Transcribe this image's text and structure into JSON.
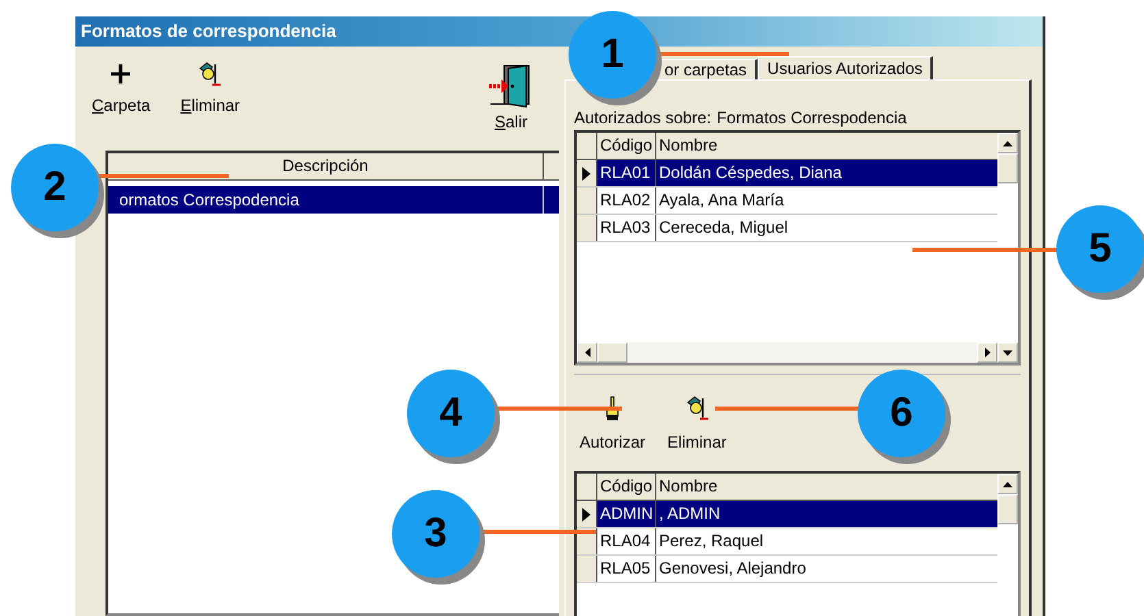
{
  "window": {
    "title": "Formatos de correspondencia"
  },
  "toolbar": [
    {
      "kind": "add",
      "label": "Carpeta",
      "underline_first": true
    },
    {
      "kind": "delete",
      "label": "Eliminar",
      "underline_first": true
    }
  ],
  "exit_button": {
    "label": "Salir",
    "underline_first": true
  },
  "folders_table": {
    "columns": [
      "Descripción"
    ],
    "rows": [
      {
        "cells": [
          "ormatos Correspodencia"
        ],
        "selected": true
      }
    ]
  },
  "tabs": [
    {
      "label": "or carpetas",
      "selected": false
    },
    {
      "label": "Usuarios Autorizados",
      "selected": true
    }
  ],
  "authorized_on": {
    "label": "Autorizados sobre:",
    "value": "Formatos Correspodencia"
  },
  "authorized_users": {
    "columns": [
      "Código",
      "Nombre"
    ],
    "rows": [
      {
        "cells": [
          "RLA01",
          "Doldán Céspedes, Diana"
        ],
        "selected": true
      },
      {
        "cells": [
          "RLA02",
          "Ayala, Ana María"
        ],
        "selected": false
      },
      {
        "cells": [
          "RLA03",
          "Cereceda, Miguel"
        ],
        "selected": false
      }
    ]
  },
  "actions": [
    {
      "kind": "authorize",
      "label": "Autorizar"
    },
    {
      "kind": "delete",
      "label": "Eliminar"
    }
  ],
  "available_users": {
    "columns": [
      "Código",
      "Nombre"
    ],
    "rows": [
      {
        "cells": [
          "ADMIN",
          ", ADMIN"
        ],
        "selected": true
      },
      {
        "cells": [
          "RLA04",
          "Perez, Raquel"
        ],
        "selected": false
      },
      {
        "cells": [
          "RLA05",
          "Genovesi, Alejandro"
        ],
        "selected": false
      }
    ]
  },
  "callouts": [
    "1",
    "2",
    "3",
    "4",
    "5",
    "6"
  ]
}
